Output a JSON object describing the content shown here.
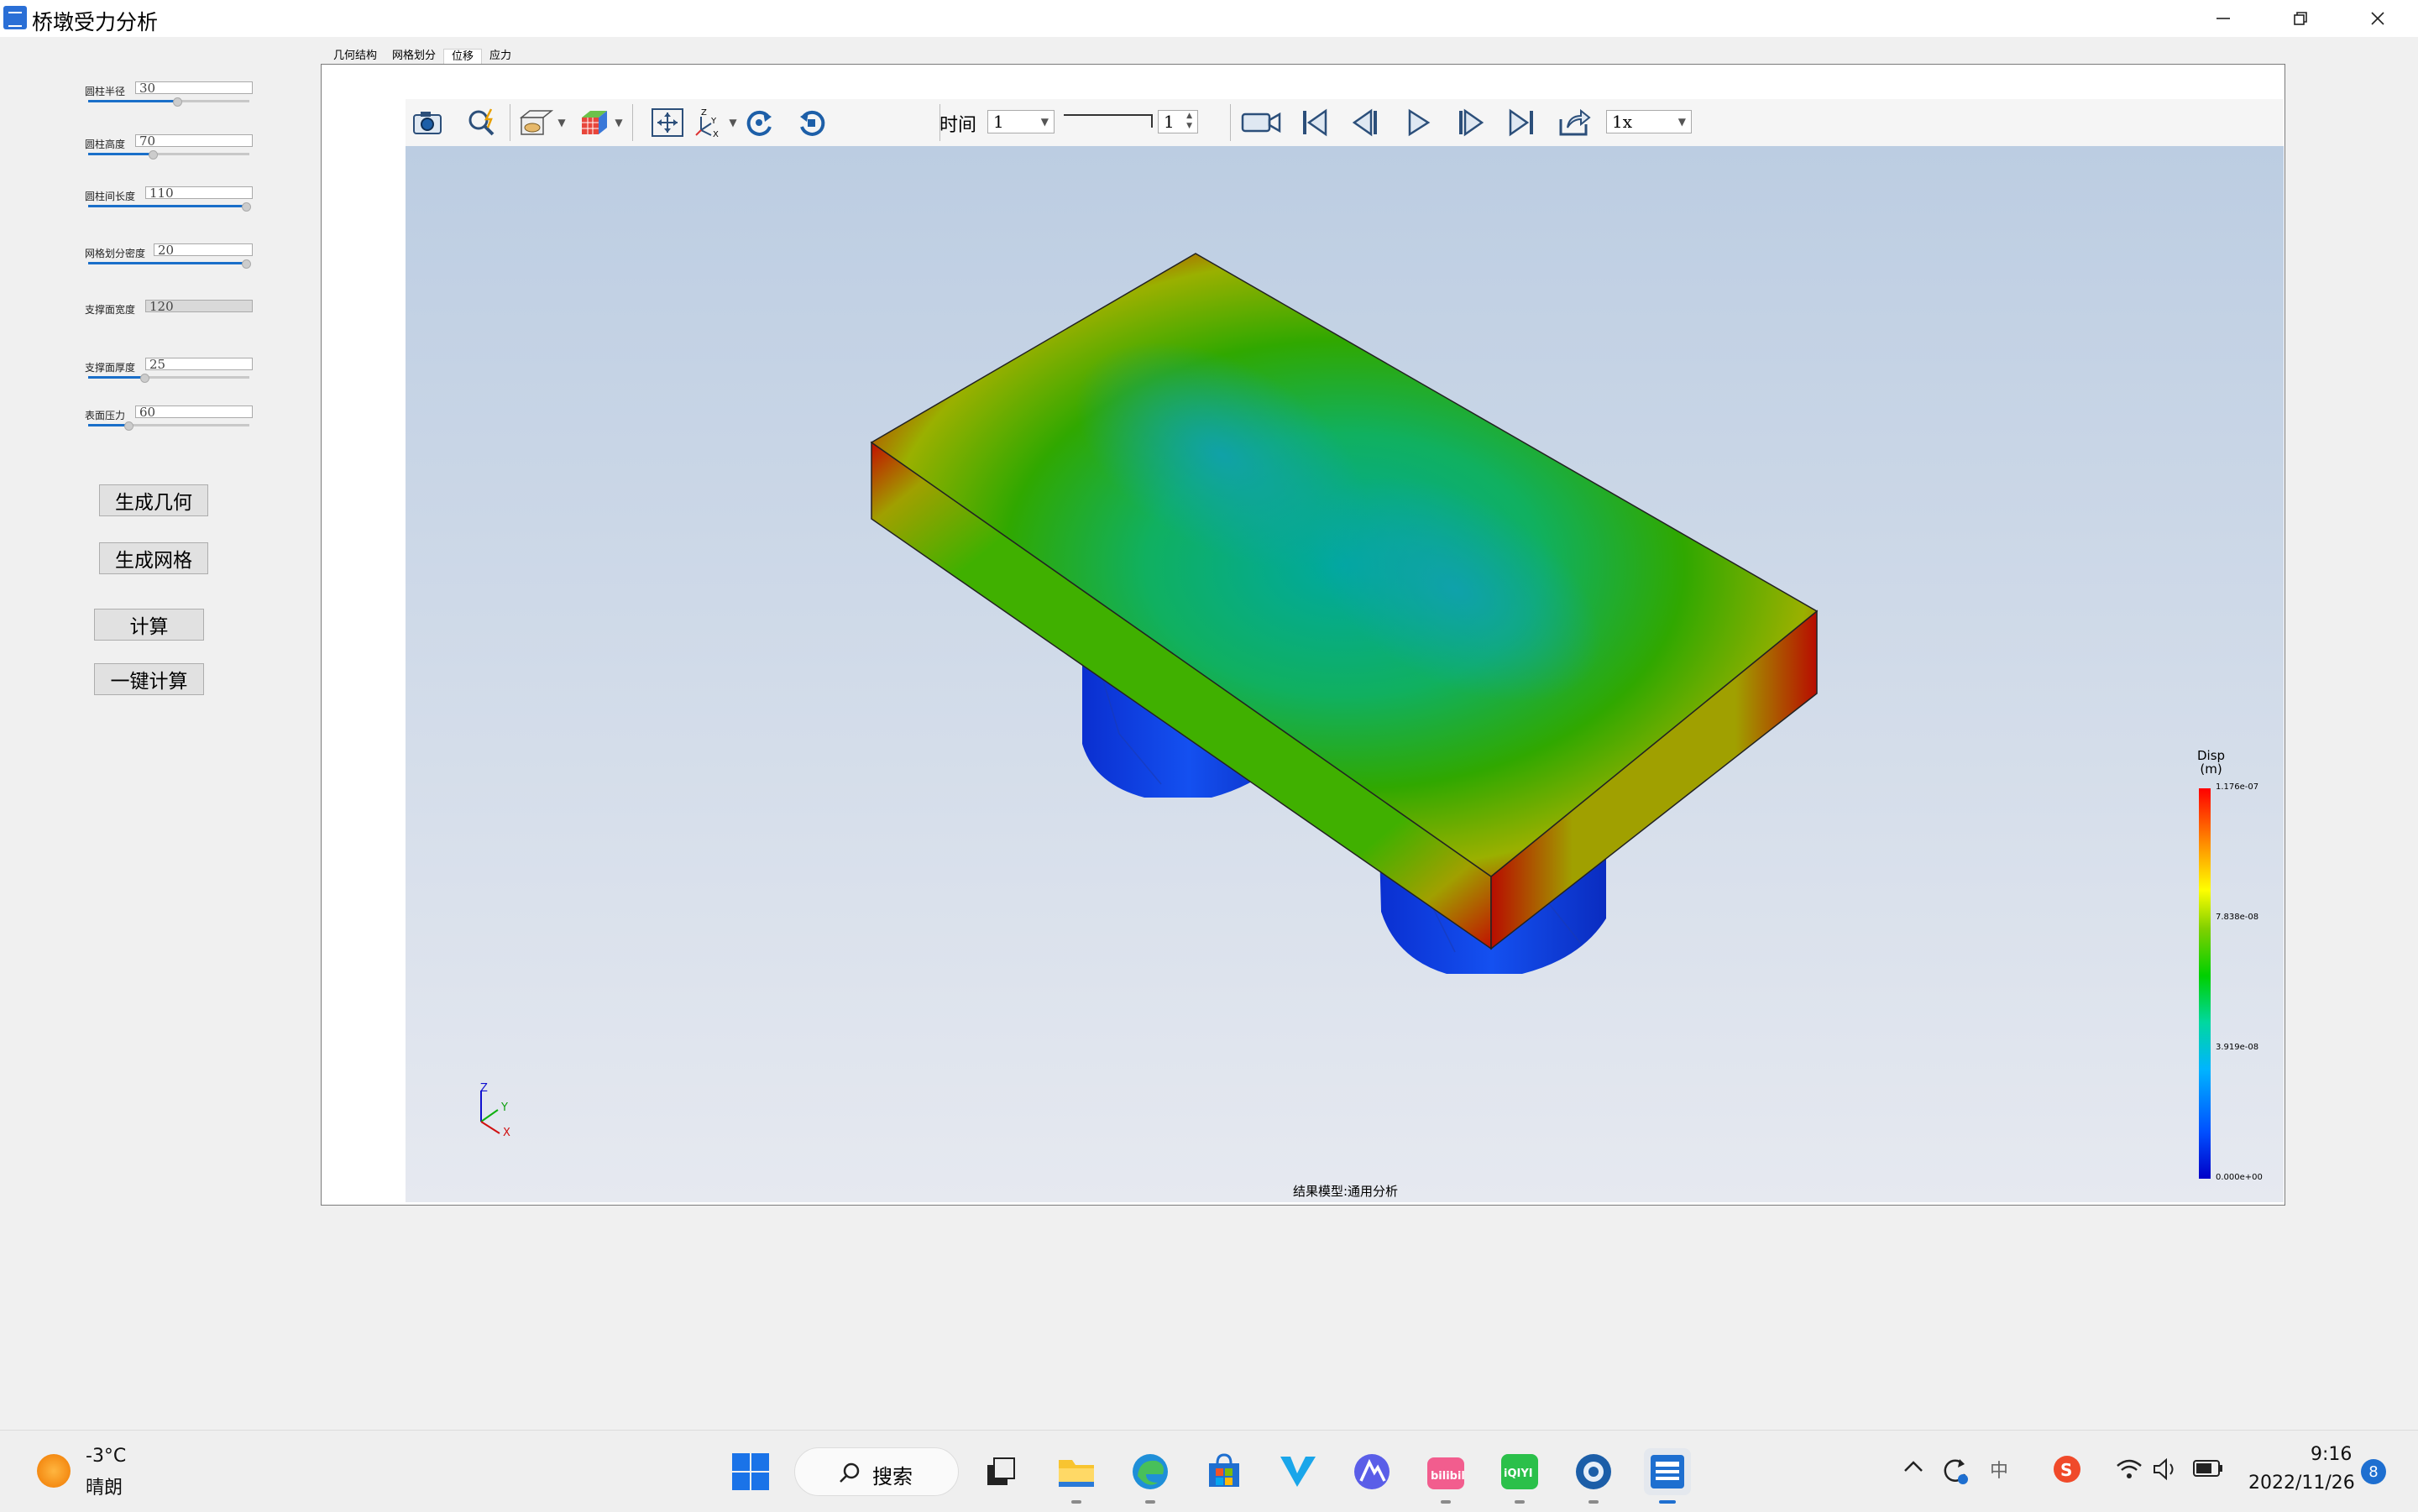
{
  "window": {
    "title": "桥墩受力分析",
    "controls": [
      "minimize",
      "restore",
      "close"
    ]
  },
  "params": [
    {
      "label": "圆柱半径",
      "value": "30",
      "slider_fraction": 0.55,
      "enabled": true
    },
    {
      "label": "圆柱高度",
      "value": "70",
      "slider_fraction": 0.4,
      "enabled": true
    },
    {
      "label": "圆柱间长度",
      "value": "110",
      "slider_fraction": 0.98,
      "enabled": true
    },
    {
      "label": "网格划分密度",
      "value": "20",
      "slider_fraction": 0.98,
      "enabled": true
    },
    {
      "label": "支撑面宽度",
      "value": "120",
      "slider_fraction": null,
      "enabled": false
    },
    {
      "label": "支撑面厚度",
      "value": "25",
      "slider_fraction": 0.35,
      "enabled": true
    },
    {
      "label": "表面压力",
      "value": "60",
      "slider_fraction": 0.25,
      "enabled": true
    }
  ],
  "buttons": {
    "gen_geometry": "生成几何",
    "gen_mesh": "生成网格",
    "compute": "计算",
    "one_click": "一键计算"
  },
  "tabs": [
    {
      "label": "几何结构",
      "active": false
    },
    {
      "label": "网格划分",
      "active": false
    },
    {
      "label": "位移",
      "active": true
    },
    {
      "label": "应力",
      "active": false
    }
  ],
  "toolbar": {
    "icons": [
      "camera-icon",
      "zoom-icon",
      "display-mode-icon",
      "color-cube-icon",
      "fit-view-icon",
      "axes-icon",
      "rotate-cw-icon",
      "rotate-ccw-icon"
    ],
    "time_label": "时间",
    "time_value": "1",
    "frame_value": "1",
    "speed_value": "1x",
    "playback_icons": [
      "record-video-icon",
      "first-frame-icon",
      "prev-frame-icon",
      "play-icon",
      "next-frame-icon",
      "last-frame-icon",
      "export-icon"
    ]
  },
  "viewport": {
    "legend_title_line1": "Disp",
    "legend_title_line2": "(m)",
    "legend_ticks": [
      {
        "label": "1.176e-07",
        "fraction": 1.0
      },
      {
        "label": "7.838e-08",
        "fraction": 0.6667
      },
      {
        "label": "3.919e-08",
        "fraction": 0.3333
      },
      {
        "label": "0.000e+00",
        "fraction": 0.0
      }
    ],
    "axis_labels": {
      "x": "X",
      "y": "Y",
      "z": "Z"
    },
    "result_model": "结果模型:通用分析",
    "colors": {
      "high": "#d20000",
      "mid": "#00b000",
      "low": "#0010d0"
    }
  },
  "taskbar": {
    "weather_temp": "-3°C",
    "weather_desc": "晴朗",
    "search_label": "搜索",
    "apps": [
      "windows-start-icon",
      "search-box",
      "task-view-icon",
      "file-explorer-icon",
      "edge-icon",
      "ms-store-icon",
      "v-app-icon",
      "a-app-icon",
      "bilibili-icon",
      "iqiyi-icon",
      "steam-like-icon",
      "bridge-app-icon"
    ],
    "ime": "中",
    "clock_time": "9:16",
    "clock_date": "2022/11/26",
    "notification_count": "8"
  }
}
